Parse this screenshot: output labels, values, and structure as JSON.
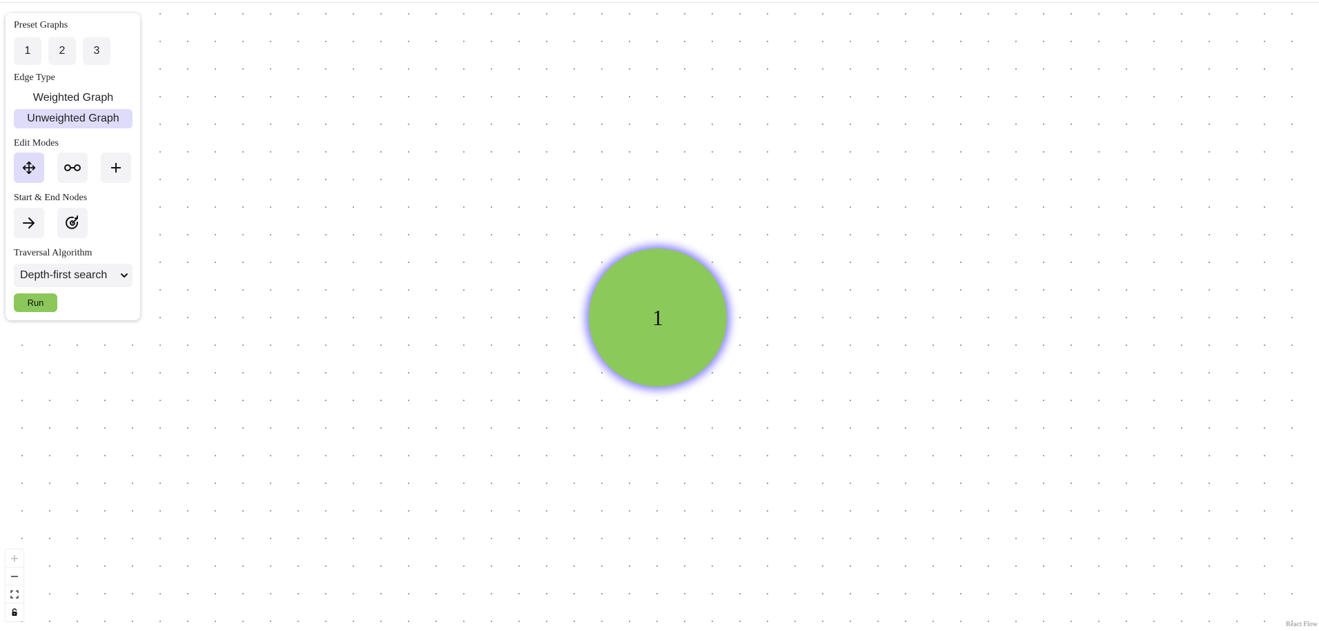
{
  "panel": {
    "preset_graphs": {
      "title": "Preset Graphs",
      "buttons": [
        "1",
        "2",
        "3"
      ]
    },
    "edge_type": {
      "title": "Edge Type",
      "options": [
        "Weighted Graph",
        "Unweighted Graph"
      ],
      "selected": "Unweighted Graph"
    },
    "edit_modes": {
      "title": "Edit Modes",
      "modes": [
        "move-icon",
        "connect-edge-icon",
        "plus-icon"
      ],
      "active": "move-icon"
    },
    "start_end_nodes": {
      "title": "Start & End Nodes",
      "buttons": [
        "arrow-right-icon",
        "target-icon"
      ]
    },
    "traversal": {
      "title": "Traversal Algorithm",
      "selected": "Depth-first search"
    },
    "run_label": "Run"
  },
  "graph": {
    "nodes": [
      {
        "label": "1",
        "color": "#8cc95b",
        "glow": "#8c85ff"
      }
    ]
  },
  "controls": [
    "zoom-in-icon",
    "zoom-out-icon",
    "fit-view-icon",
    "lock-icon"
  ],
  "attribution": "React Flow",
  "colors": {
    "accent_selected": "#dedcfa",
    "run_button": "#8bc75a",
    "button_bg": "#f3f3f6"
  }
}
